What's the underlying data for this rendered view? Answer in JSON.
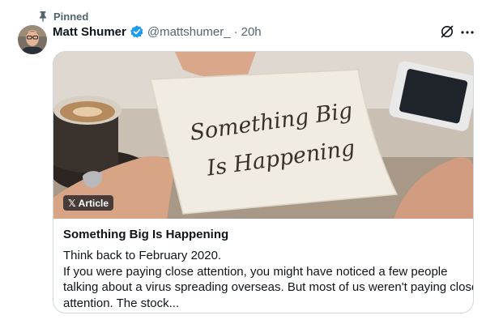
{
  "pinned": {
    "label": "Pinned"
  },
  "author": {
    "name": "Matt Shumer",
    "handle": "@mattshumer_",
    "separator": "·",
    "time": "20h",
    "verified": true
  },
  "card": {
    "badge_icon": "x-logo-icon",
    "badge_label": "Article",
    "note_text": [
      "Something Big",
      "Is Happening"
    ],
    "title": "Something Big Is Happening",
    "excerpt": [
      "Think back to February 2020.",
      "If you were paying close attention, you might have noticed a few people",
      "talking about a virus spreading overseas. But most of us weren't paying close",
      "attention. The stock..."
    ]
  },
  "icons": [
    "pin-icon",
    "verified-badge-icon",
    "grok-icon",
    "more-icon",
    "x-logo-icon"
  ],
  "colors": {
    "verified": "#1d9bf0",
    "secondary_text": "#536471",
    "border": "#cfd9de"
  }
}
